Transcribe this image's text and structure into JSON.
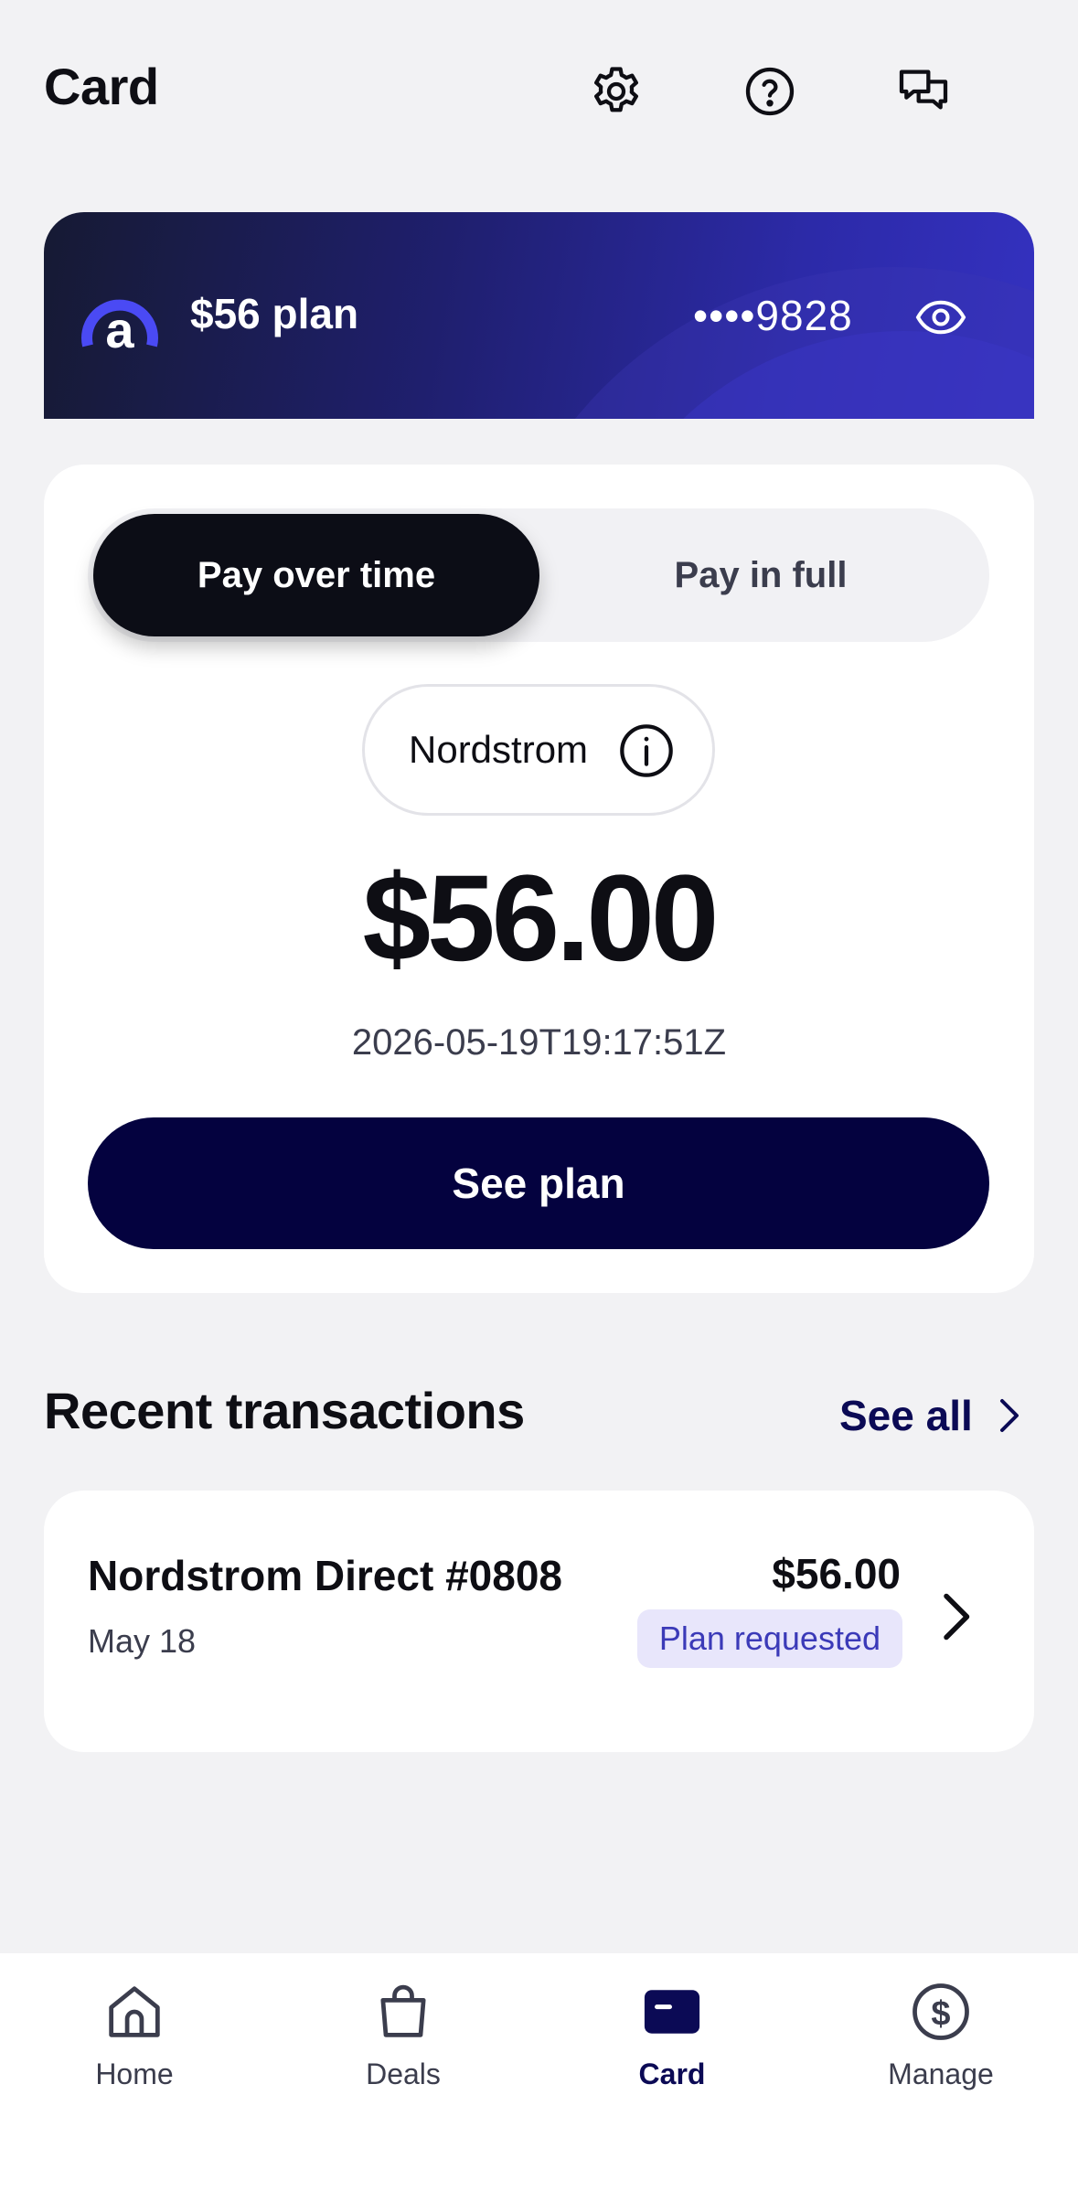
{
  "header": {
    "title": "Card",
    "icons": [
      "gear-icon",
      "help-icon",
      "chat-icon"
    ]
  },
  "card_banner": {
    "plan_label": "$56 plan",
    "card_number": "••••9828",
    "icons": [
      "affirm-logo",
      "eye-icon"
    ]
  },
  "pay_panel": {
    "toggle": {
      "active": "Pay over time",
      "inactive": "Pay in full"
    },
    "merchant": "Nordstrom",
    "amount": "$56.00",
    "timestamp": "2026-05-19T19:17:51Z",
    "cta": "See plan"
  },
  "recent_transactions": {
    "title": "Recent transactions",
    "see_all": "See all",
    "items": [
      {
        "merchant": "Nordstrom Direct #0808",
        "date": "May 18",
        "amount": "$56.00",
        "status": "Plan requested"
      }
    ]
  },
  "bottom_nav": {
    "items": [
      {
        "label": "Home",
        "icon": "home-icon",
        "active": false
      },
      {
        "label": "Deals",
        "icon": "bag-icon",
        "active": false
      },
      {
        "label": "Card",
        "icon": "card-icon",
        "active": true
      },
      {
        "label": "Manage",
        "icon": "dollar-icon",
        "active": false
      }
    ]
  },
  "colors": {
    "background": "#f2f2f4",
    "primary_navy": "#04023f",
    "active_nav": "#0b0a55",
    "badge_bg": "#e8e6fb",
    "badge_text": "#3b3ab8",
    "brand_accent": "#4a4af4"
  }
}
